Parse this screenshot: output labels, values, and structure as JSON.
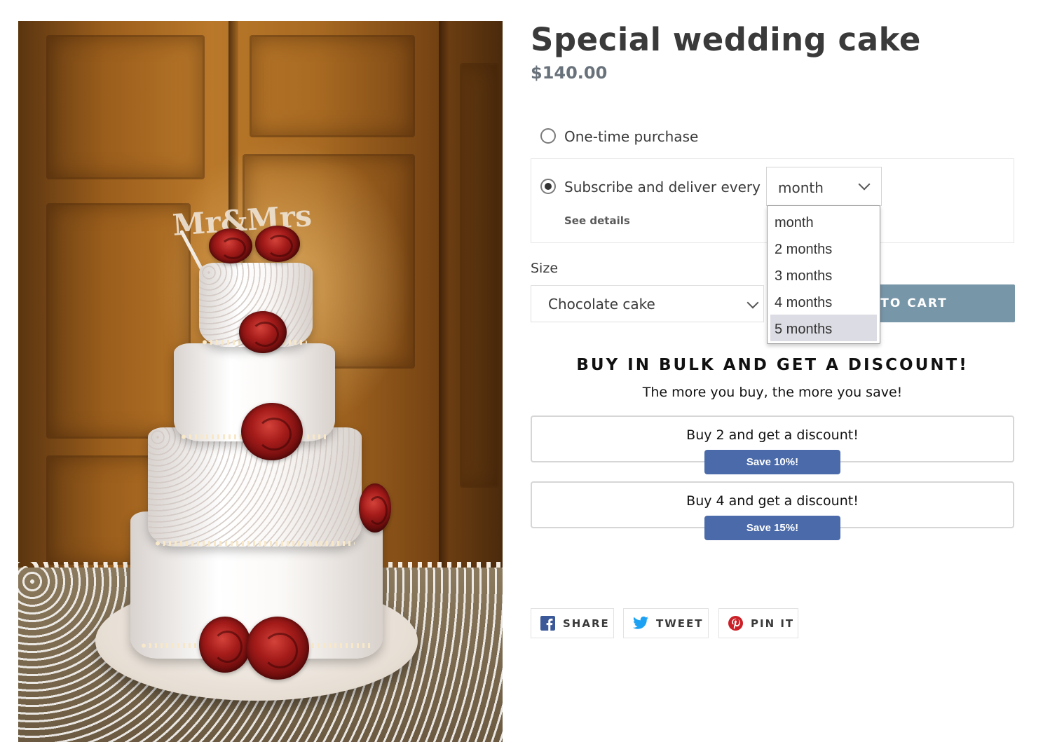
{
  "product": {
    "title": "Special wedding cake",
    "price": "$140.00",
    "image_alt": "Four-tier white wedding cake decorated with red roses"
  },
  "purchase_options": {
    "one_time_label": "One-time purchase",
    "subscribe_label": "Subscribe and deliver every",
    "see_details_label": "See details",
    "selected_option": "subscribe",
    "frequency": {
      "value": "month",
      "options": [
        "month",
        "2 months",
        "3 months",
        "4 months",
        "5 months"
      ],
      "highlighted": "5 months"
    }
  },
  "size": {
    "label": "Size",
    "value": "Chocolate cake"
  },
  "add_to_cart": {
    "label_visible": "TO CART",
    "color": "#7796a8"
  },
  "bulk": {
    "title": "BUY IN BULK AND GET A DISCOUNT!",
    "subtitle": "The more you buy, the more you save!",
    "tiers": [
      {
        "text": "Buy 2 and get a discount!",
        "badge": "Save 10%!"
      },
      {
        "text": "Buy 4 and get a discount!",
        "badge": "Save 15%!"
      }
    ],
    "badge_color": "#4a6aa9"
  },
  "share": {
    "facebook": {
      "label": "SHARE",
      "icon": "facebook-icon",
      "color": "#3b5998"
    },
    "twitter": {
      "label": "TWEET",
      "icon": "twitter-icon",
      "color": "#1da1f2"
    },
    "pinterest": {
      "label": "PIN IT",
      "icon": "pinterest-icon",
      "color": "#cb2027"
    }
  }
}
